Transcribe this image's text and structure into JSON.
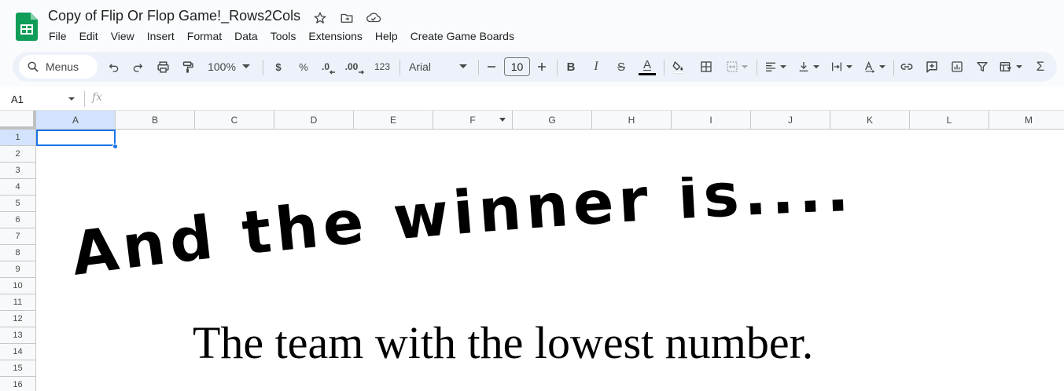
{
  "window": {
    "doc_title": "Copy of Flip Or Flop Game!_Rows2Cols"
  },
  "menubar": {
    "items": [
      "File",
      "Edit",
      "View",
      "Insert",
      "Format",
      "Data",
      "Tools",
      "Extensions",
      "Help",
      "Create Game Boards"
    ]
  },
  "toolbar": {
    "search_label": "Menus",
    "zoom": "100%",
    "currency": "$",
    "percent": "%",
    "decrease_decimal": ".0",
    "increase_decimal": ".00",
    "number_format": "123",
    "font": "Arial",
    "font_size": "10",
    "bold": "B",
    "italic": "I",
    "strikethrough": "S",
    "text_color": "A",
    "sum": "Σ"
  },
  "formula_bar": {
    "name_box": "A1",
    "fx": "fx"
  },
  "sheet": {
    "columns": [
      "A",
      "B",
      "C",
      "D",
      "E",
      "F",
      "G",
      "H",
      "I",
      "J",
      "K",
      "L",
      "M"
    ],
    "rows": [
      "1",
      "2",
      "3",
      "4",
      "5",
      "6",
      "7",
      "8",
      "9",
      "10",
      "11",
      "12",
      "13",
      "14",
      "15",
      "16"
    ],
    "selected_cell": "A1",
    "filter_column": "F"
  },
  "content": {
    "wordart": "And the winner is....",
    "subtitle": "The team with the lowest number."
  },
  "colors": {
    "accent": "#1a73e8",
    "sheets_green": "#0f9d58",
    "toolbar_bg": "#edf2fa"
  }
}
